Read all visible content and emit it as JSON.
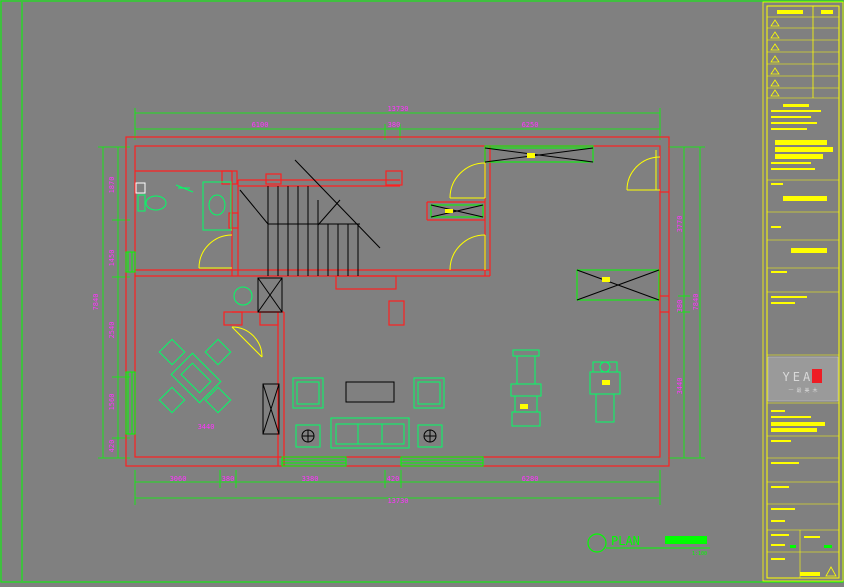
{
  "colors": {
    "background": "#808080",
    "wall": "#ff2020",
    "dimension": "#00ff00",
    "dimension_text": "#ff33ff",
    "furniture": "#00ff66",
    "stair": "#000000",
    "titleblock": "#ffff00",
    "frame": "#00ff00"
  },
  "dimensions": {
    "top_total": "13730",
    "top_left": "6100",
    "top_mid": "380",
    "top_right": "6250",
    "bottom_total": "13730",
    "bottom_1": "3060",
    "bottom_2": "380",
    "bottom_3": "3380",
    "bottom_4": "420",
    "bottom_5": "6280",
    "left_total": "7840",
    "left_1": "1870",
    "left_2": "1450",
    "left_3": "2540",
    "left_4": "1560",
    "left_5": "420",
    "right_total": "7840",
    "right_1": "3770",
    "right_2": "380",
    "right_3": "3440",
    "inner_width": "3440"
  },
  "plan_label": {
    "title": "PLAN",
    "scale_tag": "1:100"
  },
  "title_block": {
    "logo": "YEAH",
    "logo_sub": "一 最 美 木"
  }
}
